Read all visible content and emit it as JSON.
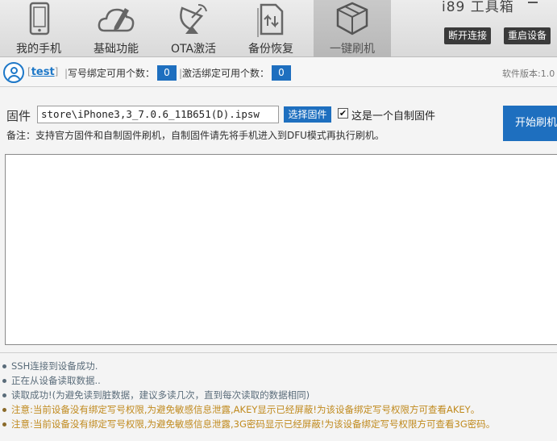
{
  "app": {
    "title": "i89 工具箱",
    "disconnect_label": "断开连接",
    "restart_label": "重启设备",
    "version_label": "软件版本:1.0"
  },
  "nav": [
    {
      "label": "我的手机",
      "icon": "phone-icon",
      "active": false
    },
    {
      "label": "基础功能",
      "icon": "cloud-edit-icon",
      "active": false
    },
    {
      "label": "OTA激活",
      "icon": "satellite-dish-icon",
      "active": false
    },
    {
      "label": "备份恢复",
      "icon": "backup-icon",
      "active": false
    },
    {
      "label": "一键刷机",
      "icon": "box-icon",
      "active": true
    }
  ],
  "user": {
    "name": "test",
    "write_bind_label": "写号绑定可用个数：",
    "write_bind_count": "0",
    "activate_bind_label": "激活绑定可用个数：",
    "activate_bind_count": "0"
  },
  "firmware": {
    "label": "固件",
    "path": "store\\iPhone3,3_7.0.6_11B651(D).ipsw",
    "select_label": "选择固件",
    "custom_checked": true,
    "custom_label": "这是一个自制固件",
    "start_label": "开始刷机",
    "note": "备注：支持官方固件和自制固件刷机，自制固件请先将手机进入到DFU模式再执行刷机。"
  },
  "status_log": [
    {
      "text": "SSH连接到设备成功.",
      "color": "#5a6c7a"
    },
    {
      "text": "正在从设备读取数据..",
      "color": "#5a6c7a"
    },
    {
      "text": "读取成功!(为避免读到脏数据，建议多读几次，直到每次读取的数据相同)",
      "color": "#5a6c7a"
    },
    {
      "text": "注意:当前设备没有绑定写号权限,为避免敏感信息泄露,AKEY显示已经屏蔽!为该设备绑定写号权限方可查看AKEY。",
      "color": "#c08a1e"
    },
    {
      "text": "注意:当前设备没有绑定写号权限,为避免敏感信息泄露,3G密码显示已经屏蔽!为该设备绑定写号权限方可查看3G密码。",
      "color": "#c08a1e"
    }
  ],
  "colors": {
    "accent": "#1e6fbf",
    "dark_button": "#3a3a3a",
    "warning_text": "#c08a1e"
  }
}
